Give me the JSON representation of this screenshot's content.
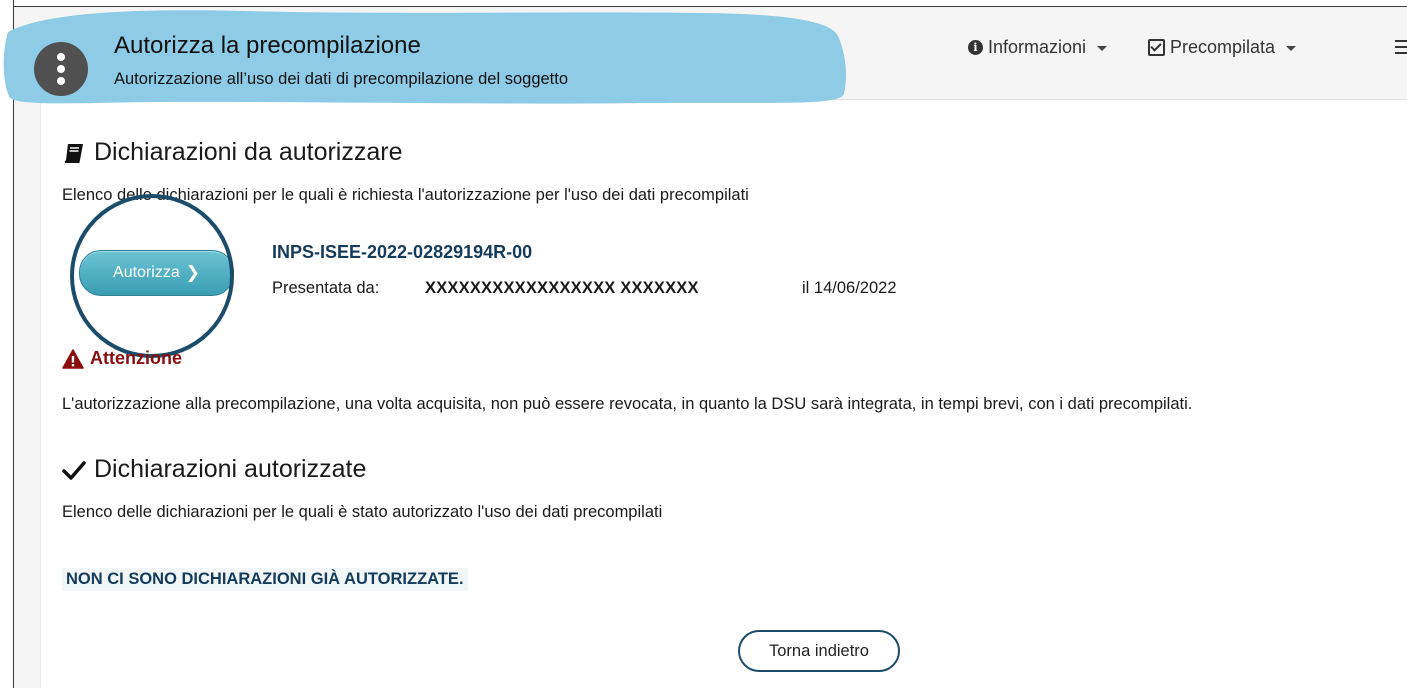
{
  "header": {
    "title": "Autorizza la precompilazione",
    "subtitle": "Autorizzazione all’uso dei dati di precompilazione del soggetto"
  },
  "topmenu": {
    "informazioni": "Informazioni",
    "precompilata": "Precompilata"
  },
  "to_authorize": {
    "heading": "Dichiarazioni da autorizzare",
    "description": "Elenco delle dichiarazioni per le quali è richiesta l'autorizzazione per l'uso dei dati precompilati",
    "button_label": "Autorizza",
    "declaration_id": "INPS-ISEE-2022-02829194R-00",
    "presented_by_label": "Presentata da:",
    "presented_by_name": "XXXXXXXXXXXXXXXXX XXXXXXX",
    "presented_date": "il 14/06/2022"
  },
  "warning": {
    "title": "Attenzione",
    "text": "L'autorizzazione alla precompilazione, una volta acquisita, non può essere revocata, in quanto la DSU sarà integrata, in tempi brevi, con i dati precompilati."
  },
  "authorized": {
    "heading": "Dichiarazioni autorizzate",
    "description": "Elenco delle dichiarazioni per le quali è stato autorizzato l'uso dei dati precompilati",
    "empty_message": "NON CI SONO DICHIARAZIONI GIÀ AUTORIZZATE."
  },
  "back_button": "Torna indietro",
  "colors": {
    "banner_highlight": "#8ecbe6",
    "accent_button": "#4aa9bd",
    "dark_blue": "#143a5c",
    "warning_red": "#8a0e0e"
  },
  "icons": [
    "kebab-icon",
    "info-icon",
    "check-square-icon",
    "menu-icon",
    "book-icon",
    "warning-icon",
    "check-icon",
    "chevron-right-icon"
  ]
}
